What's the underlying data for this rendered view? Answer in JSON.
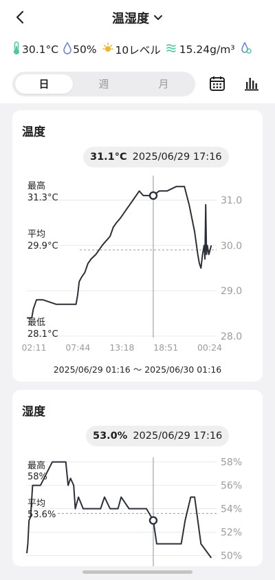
{
  "header": {
    "title": "温湿度"
  },
  "stats": {
    "temperature": "30.1°C",
    "humidity": "50%",
    "light": "10レベル",
    "absolute_humidity": "15.24g/m³"
  },
  "tabs": [
    {
      "label": "日",
      "active": true
    },
    {
      "label": "週",
      "active": false
    },
    {
      "label": "月",
      "active": false
    }
  ],
  "temperature_card": {
    "title": "温度",
    "tooltip_value": "31.1°C",
    "tooltip_time": "2025/06/29 17:16",
    "max_label": "最高",
    "max_value": "31.3°C",
    "avg_label": "平均",
    "avg_value": "29.9°C",
    "min_label": "最低",
    "min_value": "28.1°C",
    "range": "2025/06/29 01:16 ～ 2025/06/30 01:16"
  },
  "humidity_card": {
    "title": "湿度",
    "tooltip_value": "53.0%",
    "tooltip_time": "2025/06/29 17:16",
    "max_label": "最高",
    "max_value": "58%",
    "avg_label": "平均",
    "avg_value": "53.6%"
  },
  "colors": {
    "line": "#2b2f38",
    "accent_blue": "#6b87d6",
    "light_icon": "#f0b429",
    "mint_icon": "#4cc9a0",
    "grid": "#e6e6e6"
  },
  "chart_data": [
    {
      "type": "line",
      "title": "温度",
      "x_ticks": [
        "02:11",
        "07:44",
        "13:18",
        "18:51",
        "00:24"
      ],
      "y_ticks": [
        28.0,
        29.0,
        30.0,
        31.0
      ],
      "ylim": [
        27.7,
        31.6
      ],
      "average": 29.9,
      "max": 31.3,
      "min": 28.1,
      "cursor": {
        "x": "17:16",
        "y": 31.1
      },
      "x_hours": [
        1.27,
        1.9,
        2.1,
        2.5,
        3.3,
        5.0,
        7.5,
        7.7,
        7.9,
        8.2,
        8.6,
        9.0,
        9.4,
        10.0,
        10.4,
        10.8,
        11.3,
        11.8,
        12.2,
        12.6,
        13.1,
        13.5,
        13.9,
        14.3,
        14.7,
        15.1,
        15.5,
        16.0,
        16.5,
        17.27,
        18.0,
        19.0,
        20.2,
        21.2,
        21.8,
        22.5,
        22.9,
        23.1,
        23.3,
        23.5,
        23.7,
        23.8,
        23.9,
        24.0,
        24.1,
        24.3,
        24.6
      ],
      "values": [
        28.4,
        28.4,
        28.6,
        28.8,
        28.8,
        28.7,
        28.7,
        28.9,
        29.2,
        29.3,
        29.4,
        29.6,
        29.7,
        29.8,
        29.9,
        30.0,
        30.1,
        30.2,
        30.4,
        30.5,
        30.6,
        30.7,
        30.8,
        30.9,
        31.0,
        31.1,
        31.2,
        31.1,
        31.1,
        31.1,
        31.2,
        31.2,
        31.3,
        31.3,
        30.9,
        30.3,
        29.8,
        29.6,
        29.5,
        29.8,
        30.0,
        29.7,
        30.9,
        29.8,
        30.0,
        29.8,
        30.0
      ]
    },
    {
      "type": "line",
      "title": "湿度",
      "y_ticks": [
        50,
        52,
        54,
        56,
        58
      ],
      "ylim": [
        49.5,
        58.8
      ],
      "average": 53.6,
      "max": 58,
      "cursor": {
        "x": "17:16",
        "y": 53.0
      },
      "x_hours": [
        1.27,
        1.4,
        1.55,
        1.75,
        2.0,
        2.6,
        3.0,
        4.5,
        6.2,
        6.5,
        6.8,
        7.2,
        7.4,
        7.8,
        8.4,
        9.3,
        10.6,
        11.1,
        11.8,
        12.8,
        13.2,
        14.2,
        15.6,
        16.4,
        17.27,
        17.7,
        20.8,
        21.3,
        22.0,
        22.5,
        23.3,
        24.6
      ],
      "values": [
        50.2,
        51.0,
        53.0,
        53.3,
        56.0,
        56.0,
        56.0,
        58.0,
        58.0,
        56.0,
        56.6,
        56.0,
        54.0,
        55.0,
        54.0,
        54.0,
        54.0,
        55.0,
        54.0,
        54.0,
        55.0,
        54.0,
        54.0,
        54.0,
        53.0,
        51.0,
        51.0,
        53.0,
        55.0,
        55.0,
        51.0,
        49.8
      ]
    }
  ]
}
